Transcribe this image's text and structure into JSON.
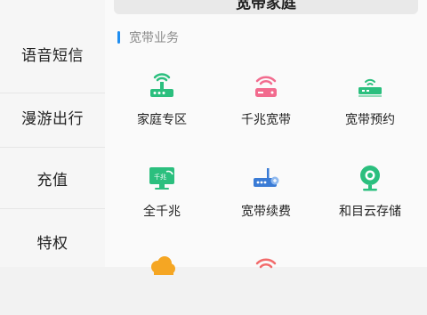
{
  "sidebar": {
    "items": [
      {
        "label": "语音短信"
      },
      {
        "label": "漫游出行"
      },
      {
        "label": "充值"
      },
      {
        "label": "特权"
      }
    ]
  },
  "banner": {
    "title": "宽带家庭"
  },
  "section": {
    "title": "宽带业务"
  },
  "grid": {
    "items": [
      {
        "label": "家庭专区",
        "icon": "router-icon"
      },
      {
        "label": "千兆宽带",
        "icon": "wifi-router-icon"
      },
      {
        "label": "宽带预约",
        "icon": "modem-icon"
      },
      {
        "label": "全千兆",
        "icon": "monitor-gigabit-icon"
      },
      {
        "label": "宽带续费",
        "icon": "router-renew-icon"
      },
      {
        "label": "和目云存储",
        "icon": "camera-icon"
      }
    ],
    "icon_monitor_text": "千兆"
  },
  "colors": {
    "accent": "#1f8ef1",
    "green": "#2bbf7e",
    "pink": "#f26b8e",
    "orange": "#f5a623"
  }
}
